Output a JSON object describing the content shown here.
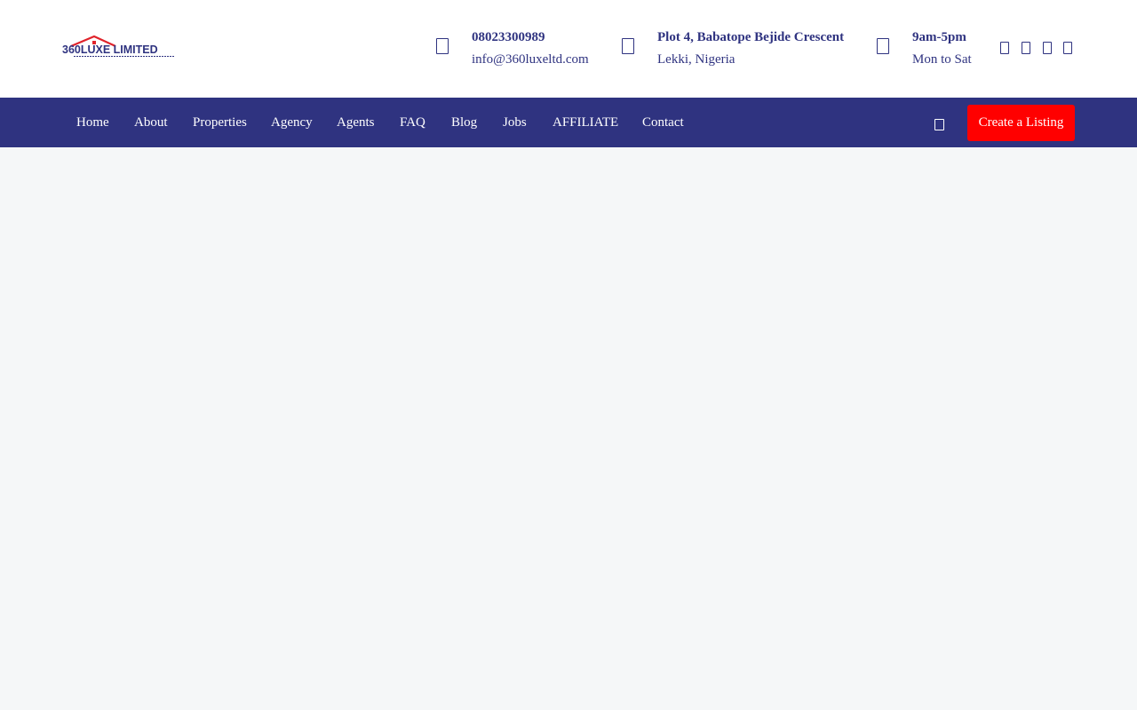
{
  "brand": {
    "logo_text": "360LUXE LIMITED",
    "primary_color": "#2f3380",
    "accent_color": "#ff0000"
  },
  "contact": {
    "phone": {
      "icon": "phone-icon",
      "line1": "08023300989",
      "line2": "info@360luxeltd.com"
    },
    "address": {
      "icon": "location-icon",
      "line1": "Plot 4, Babatope Bejide Crescent",
      "line2": "Lekki, Nigeria"
    },
    "hours": {
      "icon": "clock-icon",
      "line1": "9am-5pm",
      "line2": "Mon to Sat"
    }
  },
  "social": [
    "facebook-icon",
    "twitter-icon",
    "instagram-icon",
    "linkedin-icon"
  ],
  "nav": {
    "items": [
      "Home",
      "About",
      "Properties",
      "Agency",
      "Agents",
      "FAQ",
      "Blog",
      "Jobs",
      "AFFILIATE",
      "Contact"
    ],
    "search_icon": "search-icon",
    "cta_label": "Create a Listing"
  }
}
